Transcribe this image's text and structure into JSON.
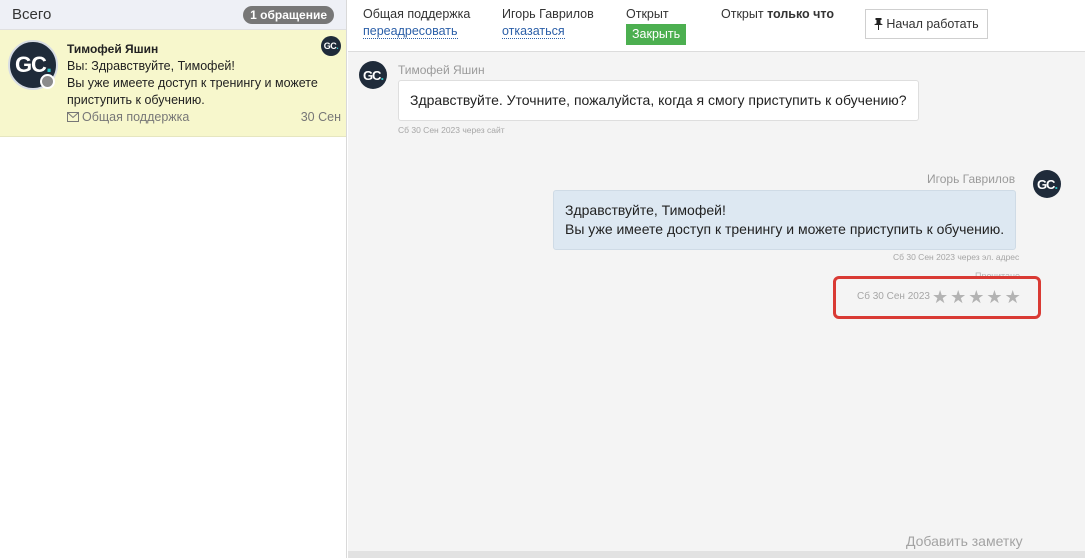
{
  "sidebar": {
    "title": "Всего",
    "count_badge": "1 обращение",
    "conversation": {
      "avatar_text_main": "GC",
      "avatar_text_accent": ".",
      "name": "Тимофей Яшин",
      "preview_line1": "Вы: Здравствуйте, Тимофей!",
      "preview_line2": "Вы уже имеете доступ к тренингу и можете приступить к обучению.",
      "channel": "Общая поддержка",
      "date": "30 Сен"
    }
  },
  "topbar": {
    "department_label": "Общая поддержка",
    "forward_link": "переадресовать",
    "assignee_label": "Игорь Гаврилов",
    "decline_link": "отказаться",
    "status_label": "Открыт",
    "close_button": "Закрыть",
    "opened_prefix": "Открыт",
    "opened_when": "только что",
    "start_button": "Начал работать"
  },
  "messages": {
    "incoming": {
      "author": "Тимофей Яшин",
      "text": "Здравствуйте. Уточните, пожалуйста, когда я смогу приступить к обучению?",
      "meta": "Сб 30 Сен 2023 через сайт"
    },
    "outgoing": {
      "author": "Игорь Гаврилов",
      "line1": "Здравствуйте, Тимофей!",
      "line2": "Вы уже имеете доступ к тренингу и можете приступить к обучению.",
      "meta": "Сб 30 Сен 2023 через эл. адрес",
      "faint_label": "Прочитано"
    }
  },
  "rating": {
    "date": "Сб 30 Сен 2023",
    "stars_total": 5,
    "stars_filled": 0
  },
  "footer": {
    "add_note": "Добавить заметку"
  },
  "colors": {
    "selected_conversation_bg": "#f7f7cc",
    "close_button_bg": "#4caf50",
    "highlight_border": "#d93a34",
    "outgoing_bubble_bg": "#dde8f2",
    "avatar_bg": "#1f2b3a",
    "avatar_accent": "#30c2c7"
  }
}
